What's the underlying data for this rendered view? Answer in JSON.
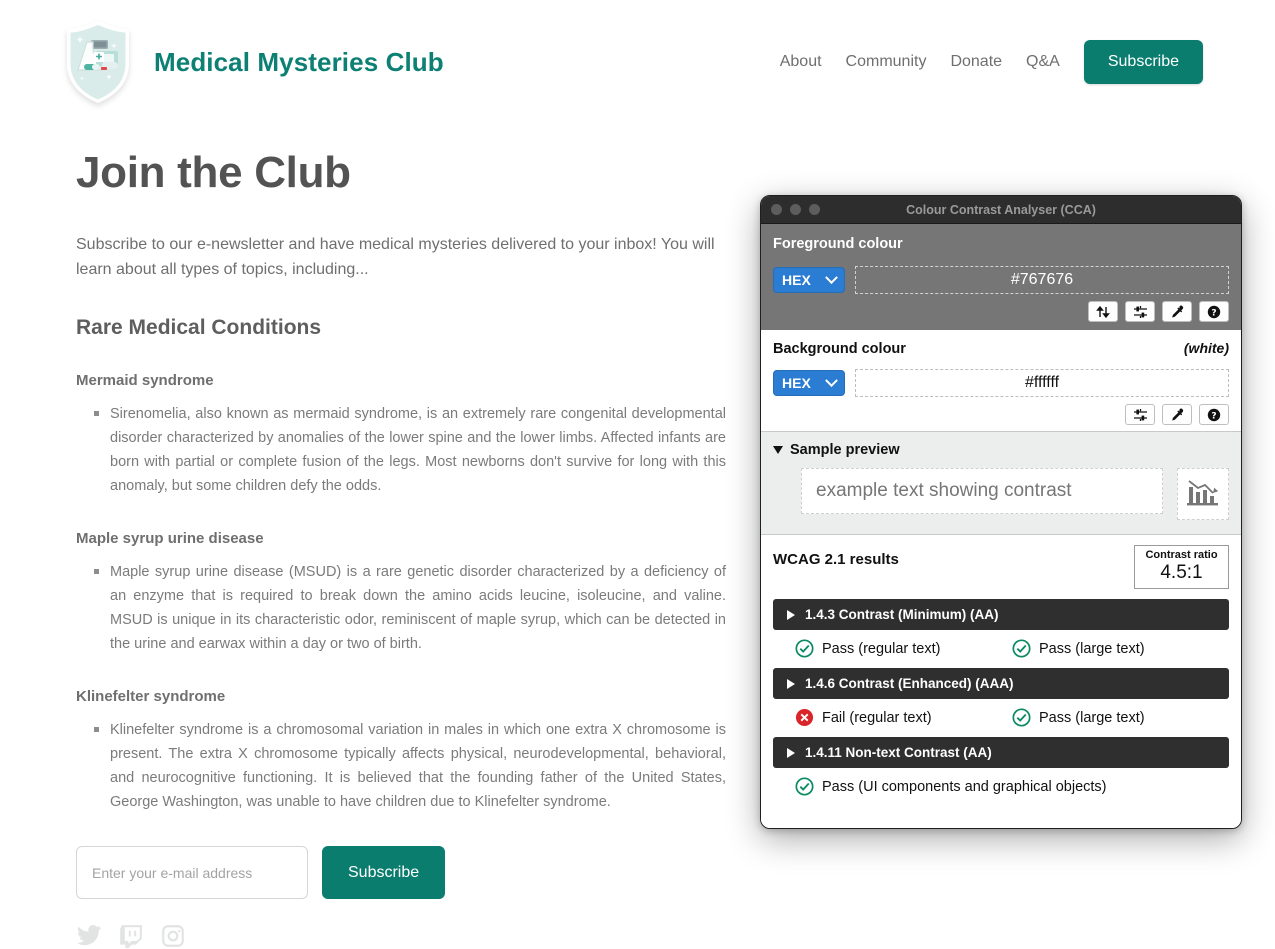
{
  "site": {
    "brand_name": "Medical Mysteries Club",
    "logo_icon": "medical-shield-logo",
    "nav": [
      {
        "label": "About"
      },
      {
        "label": "Community"
      },
      {
        "label": "Donate"
      },
      {
        "label": "Q&A"
      }
    ],
    "nav_cta_label": "Subscribe",
    "accent_color": "#0a7d6e",
    "brand_text_color": "#0d8074"
  },
  "main": {
    "title": "Join the Club",
    "lede": "Subscribe to our e-newsletter and have medical mysteries delivered to your inbox! You will learn about all types of topics, including...",
    "section_title": "Rare Medical Conditions",
    "conditions": [
      {
        "name": "Mermaid syndrome",
        "body": "Sirenomelia, also known as mermaid syndrome, is an extremely rare congenital developmental disorder characterized by anomalies of the lower spine and the lower limbs. Affected infants are born with partial or complete fusion of the legs. Most newborns don't survive for long with this anomaly, but some children defy the odds."
      },
      {
        "name": "Maple syrup urine disease",
        "body": "Maple syrup urine disease (MSUD) is a rare genetic disorder characterized by a deficiency of an enzyme that is required to break down the amino acids leucine, isoleucine, and valine. MSUD is unique in its characteristic odor, reminiscent of maple syrup, which can be detected in the urine and earwax within a day or two of birth."
      },
      {
        "name": "Klinefelter syndrome",
        "body": "Klinefelter syndrome is a chromosomal variation in males in which one extra X chromosome is present. The extra X chromosome typically affects physical, neurodevelopmental, behavioral, and neurocognitive functioning. It is believed that the founding father of the United States, George Washington, was unable to have children due to Klinefelter syndrome."
      }
    ],
    "email_placeholder": "Enter your e-mail address",
    "email_value": "",
    "subscribe_label": "Subscribe",
    "social": [
      {
        "icon": "twitter-icon",
        "name": "Twitter"
      },
      {
        "icon": "twitch-icon",
        "name": "Twitch"
      },
      {
        "icon": "instagram-icon",
        "name": "Instagram"
      }
    ],
    "social_color": "#e2e4e4"
  },
  "cca": {
    "window_title": "Colour Contrast Analyser (CCA)",
    "traffic_lights": [
      "close",
      "minimize",
      "zoom"
    ],
    "foreground": {
      "label": "Foreground colour",
      "format": "HEX",
      "value": "#767676",
      "swatch_color": "#767676",
      "buttons": [
        {
          "icon": "swap-colours-icon",
          "title": "Swap colours"
        },
        {
          "icon": "sliders-icon",
          "title": "Colour sliders"
        },
        {
          "icon": "eyedropper-icon",
          "title": "Pick colour"
        },
        {
          "icon": "help-icon",
          "title": "Help"
        }
      ]
    },
    "background": {
      "label": "Background colour",
      "note": "(white)",
      "format": "HEX",
      "value": "#ffffff",
      "buttons": [
        {
          "icon": "sliders-icon",
          "title": "Colour sliders"
        },
        {
          "icon": "eyedropper-icon",
          "title": "Pick colour"
        },
        {
          "icon": "help-icon",
          "title": "Help"
        }
      ]
    },
    "preview": {
      "label": "Sample preview",
      "expanded": true,
      "sample_text": "example text showing contrast",
      "chart_icon": "declining-bar-chart-icon"
    },
    "results": {
      "title": "WCAG 2.1 results",
      "ratio_label": "Contrast ratio",
      "ratio_value": "4.5:1",
      "criteria": [
        {
          "name": "1.4.3 Contrast (Minimum) (AA)",
          "expanded": false,
          "outcomes": [
            {
              "status": "pass",
              "label": "Pass (regular text)"
            },
            {
              "status": "pass",
              "label": "Pass (large text)"
            }
          ]
        },
        {
          "name": "1.4.6 Contrast (Enhanced) (AAA)",
          "expanded": false,
          "outcomes": [
            {
              "status": "fail",
              "label": "Fail (regular text)"
            },
            {
              "status": "pass",
              "label": "Pass (large text)"
            }
          ]
        },
        {
          "name": "1.4.11 Non-text Contrast (AA)",
          "expanded": false,
          "outcomes": [
            {
              "status": "pass",
              "label": "Pass (UI components and graphical objects)"
            }
          ]
        }
      ],
      "pass_color": "#0b8a63",
      "fail_color": "#d9252a"
    }
  }
}
